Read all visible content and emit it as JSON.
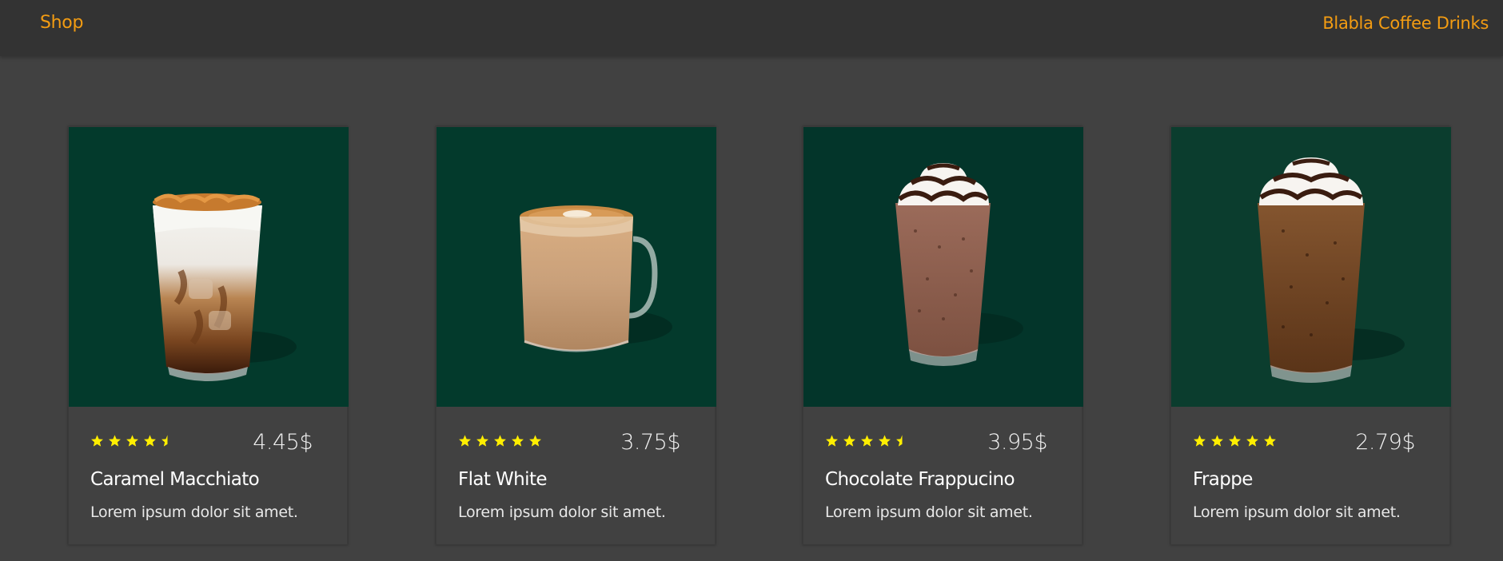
{
  "navbar": {
    "shop_label": "Shop",
    "brand_label": "Blabla Coffee Drinks"
  },
  "colors": {
    "accent": "#f39c12",
    "card_image_bg": "#033a2c",
    "star": "#ffee00"
  },
  "products": [
    {
      "name": "Caramel Macchiato",
      "price": "4.45$",
      "rating": 4.5,
      "description": "Lorem ipsum dolor sit amet.",
      "image_icon": "iced-caramel-macchiato-glass"
    },
    {
      "name": "Flat White",
      "price": "3.75$",
      "rating": 5,
      "description": "Lorem ipsum dolor sit amet.",
      "image_icon": "flat-white-mug"
    },
    {
      "name": "Chocolate Frappucino",
      "price": "3.95$",
      "rating": 4.5,
      "description": "Lorem ipsum dolor sit amet.",
      "image_icon": "chocolate-frappuccino-glass"
    },
    {
      "name": "Frappe",
      "price": "2.79$",
      "rating": 5,
      "description": "Lorem ipsum dolor sit amet.",
      "image_icon": "frappe-glass"
    }
  ]
}
